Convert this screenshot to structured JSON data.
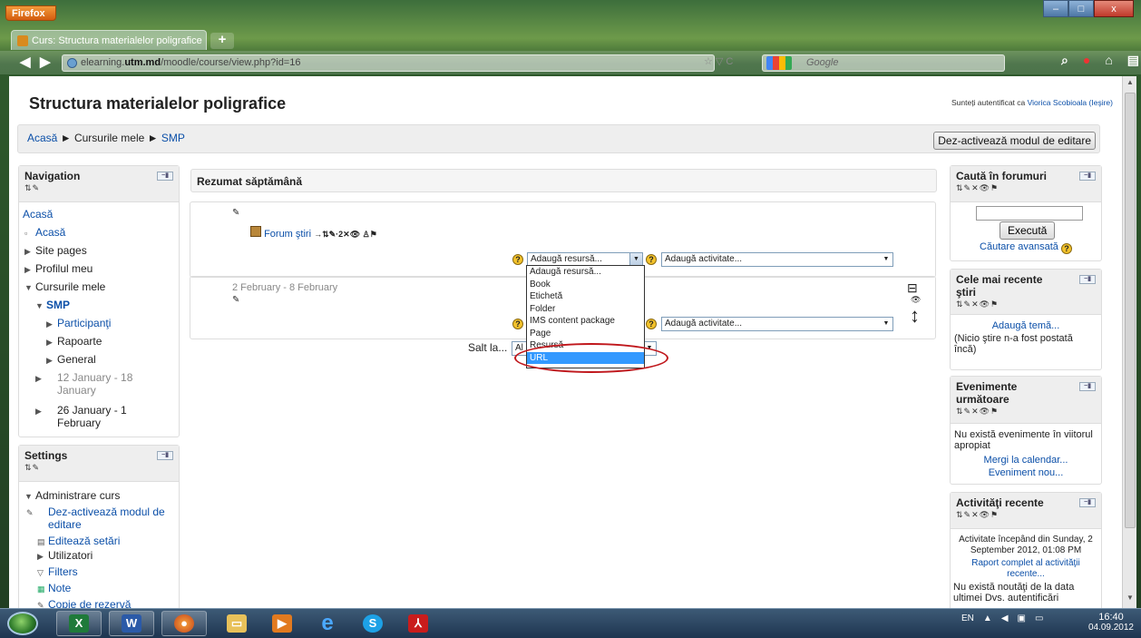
{
  "browser": {
    "menu_button": "Firefox",
    "tab_title": "Curs: Structura materialelor poligrafice",
    "new_tab": "+",
    "url_prefix": "elearning.",
    "url_domain": "utm.md",
    "url_path": "/moodle/course/view.php?id=16",
    "search_engine": "Google",
    "window_buttons": [
      "–",
      "□",
      "x"
    ]
  },
  "page": {
    "course_title": "Structura materialelor poligrafice",
    "logged_in_prefix": "Sunteți autentificat ca",
    "logged_in_user": "Viorica Scobioala",
    "logout": "(Ieşire)",
    "breadcrumb": [
      "Acasă",
      "Cursurile mele",
      "SMP"
    ],
    "breadcrumb_sep": "►",
    "edit_button": "Dez-activează modul de editare"
  },
  "navigation": {
    "title": "Navigation",
    "home": "Acasă",
    "items": [
      {
        "label": "Acasă",
        "type": "bullet"
      },
      {
        "label": "Site pages",
        "type": "collapsed"
      },
      {
        "label": "Profilul meu",
        "type": "collapsed"
      },
      {
        "label": "Cursurile mele",
        "type": "expanded"
      },
      {
        "label": "SMP",
        "type": "expanded"
      },
      {
        "label": "Participanţi",
        "type": "collapsed"
      },
      {
        "label": "Rapoarte",
        "type": "collapsed"
      },
      {
        "label": "General",
        "type": "collapsed"
      },
      {
        "label": "12 January - 18 January",
        "type": "collapsed"
      },
      {
        "label": "26 January - 1 February",
        "type": "collapsed"
      }
    ]
  },
  "settings": {
    "title": "Settings",
    "course_admin": "Administrare curs",
    "items": [
      "Dez-activează modul de editare",
      "Editează setări",
      "Utilizatori",
      "Filters",
      "Note",
      "Copie de rezervă"
    ]
  },
  "center": {
    "header": "Rezumat săptămână",
    "forum_label": "Forum ştiri",
    "section1_title": "2 February - 8 February",
    "add_resource": "Adaugă resursă...",
    "add_activity": "Adaugă activitate...",
    "jump_label": "Salt la...",
    "jump_value": "Al",
    "dropdown_options": [
      "Adaugă resursă...",
      "Book",
      "Etichetă",
      "Folder",
      "IMS content package",
      "Page",
      "Resursă",
      "URL"
    ],
    "highlighted_option": "URL"
  },
  "right": {
    "forum_search_title": "Caută în forumuri",
    "search_button": "Execută",
    "advanced_search": "Căutare avansată",
    "news_title": "Cele mai recente ştiri",
    "add_topic": "Adaugă temă...",
    "no_news": "(Nicio ştire n-a fost postată încă)",
    "events_title": "Evenimente următoare",
    "no_events": "Nu există evenimente în viitorul apropiat",
    "calendar_link": "Mergi la calendar...",
    "new_event": "Eveniment nou...",
    "activity_title": "Activităţi recente",
    "activity_since": "Activitate începând din Sunday, 2 September 2012, 01:08 PM",
    "full_report": "Raport complet al activităţii recente...",
    "no_updates": "Nu există noutăţi de la data ultimei Dvs. autentificări"
  },
  "taskbar": {
    "language": "EN",
    "time": "16:40",
    "date": "04.09.2012"
  }
}
